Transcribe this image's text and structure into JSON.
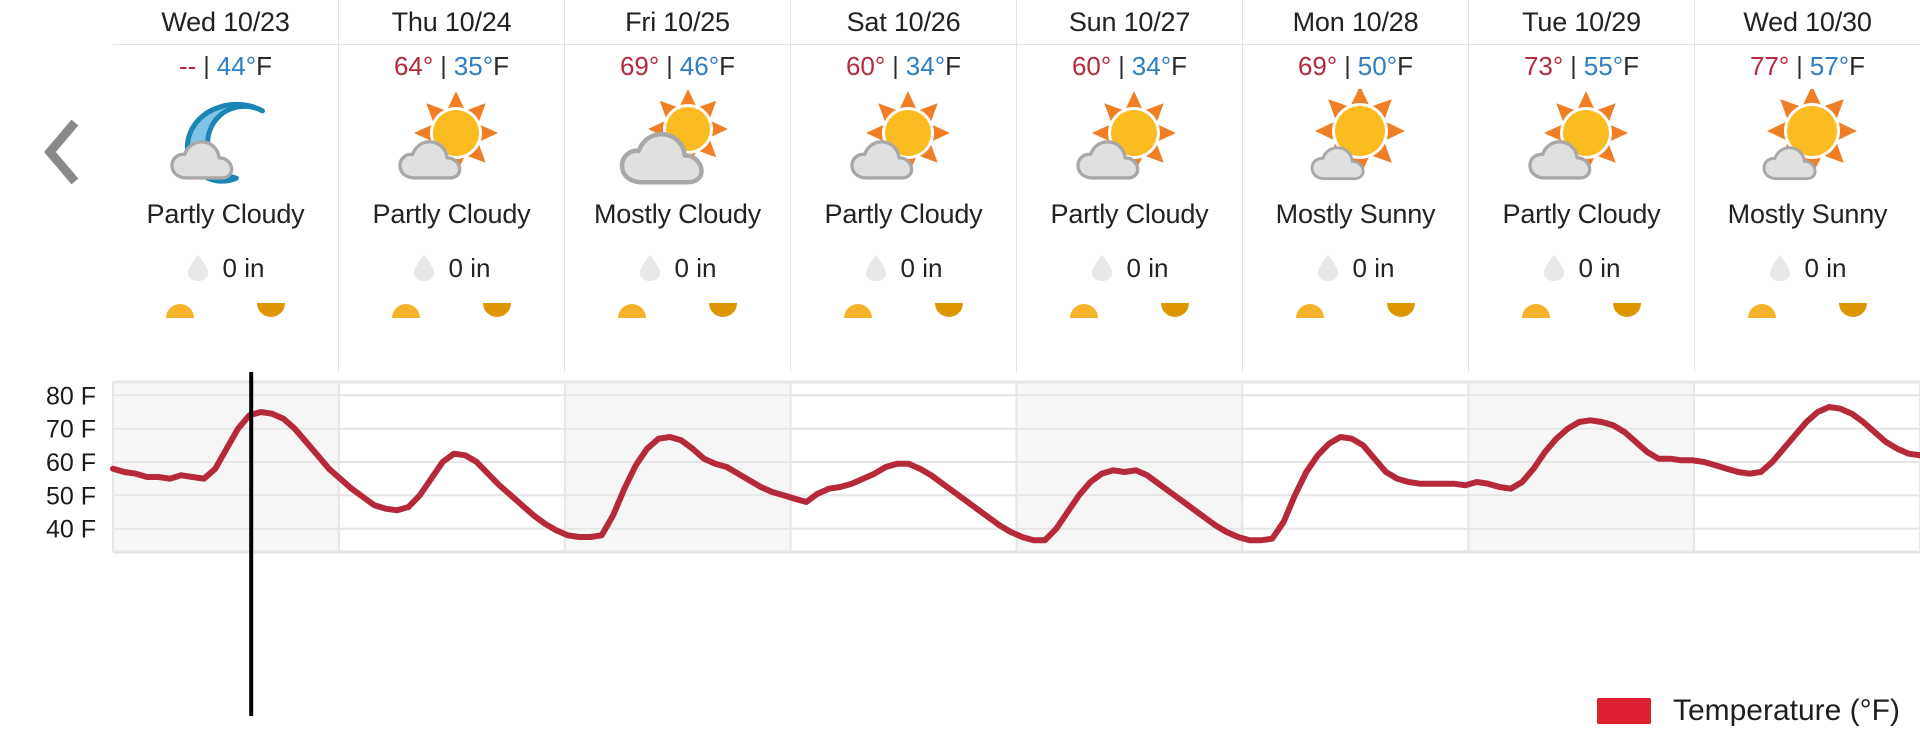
{
  "nav": {
    "prev_label": "previous days",
    "prev_icon": "chevron-left-icon"
  },
  "units": {
    "degree": "°",
    "fahrenheit": "°F",
    "separator": "|"
  },
  "days": [
    {
      "date": "Wed 10/23",
      "high": "--",
      "low": "44",
      "high_suffix": "",
      "condition": "Partly Cloudy",
      "precip": "0 in",
      "icon": "moon-cloud-icon",
      "precip_icon": "raindrop-icon",
      "sunrise_icon": "sunrise-icon",
      "sunset_icon": "sunset-icon"
    },
    {
      "date": "Thu 10/24",
      "high": "64",
      "low": "35",
      "high_suffix": "°",
      "condition": "Partly Cloudy",
      "precip": "0 in",
      "icon": "sun-cloud-icon",
      "precip_icon": "raindrop-icon",
      "sunrise_icon": "sunrise-icon",
      "sunset_icon": "sunset-icon"
    },
    {
      "date": "Fri 10/25",
      "high": "69",
      "low": "46",
      "high_suffix": "°",
      "condition": "Mostly Cloudy",
      "precip": "0 in",
      "icon": "cloud-sun-icon",
      "precip_icon": "raindrop-icon",
      "sunrise_icon": "sunrise-icon",
      "sunset_icon": "sunset-icon"
    },
    {
      "date": "Sat 10/26",
      "high": "60",
      "low": "34",
      "high_suffix": "°",
      "condition": "Partly Cloudy",
      "precip": "0 in",
      "icon": "sun-cloud-icon",
      "precip_icon": "raindrop-icon",
      "sunrise_icon": "sunrise-icon",
      "sunset_icon": "sunset-icon"
    },
    {
      "date": "Sun 10/27",
      "high": "60",
      "low": "34",
      "high_suffix": "°",
      "condition": "Partly Cloudy",
      "precip": "0 in",
      "icon": "sun-cloud-icon",
      "precip_icon": "raindrop-icon",
      "sunrise_icon": "sunrise-icon",
      "sunset_icon": "sunset-icon"
    },
    {
      "date": "Mon 10/28",
      "high": "69",
      "low": "50",
      "high_suffix": "°",
      "condition": "Mostly Sunny",
      "precip": "0 in",
      "icon": "sun-small-cloud-icon",
      "precip_icon": "raindrop-icon",
      "sunrise_icon": "sunrise-icon",
      "sunset_icon": "sunset-icon"
    },
    {
      "date": "Tue 10/29",
      "high": "73",
      "low": "55",
      "high_suffix": "°",
      "condition": "Partly Cloudy",
      "precip": "0 in",
      "icon": "sun-cloud-icon",
      "precip_icon": "raindrop-icon",
      "sunrise_icon": "sunrise-icon",
      "sunset_icon": "sunset-icon"
    },
    {
      "date": "Wed 10/30",
      "high": "77",
      "low": "57",
      "high_suffix": "°",
      "condition": "Mostly Sunny",
      "precip": "0 in",
      "icon": "sun-small-cloud-icon",
      "precip_icon": "raindrop-icon",
      "sunrise_icon": "sunrise-icon",
      "sunset_icon": "sunset-icon"
    }
  ],
  "legend": {
    "label": "Temperature (°F)",
    "color": "#dc2030"
  },
  "colors": {
    "line": "#b5293a",
    "high_temp": "#b5293a",
    "low_temp": "#2f7fc4",
    "grid": "#e6e6e6",
    "band": "#f6f6f6",
    "current_time_line": "#000000",
    "sunrise": "#f5b32b",
    "sunset": "#dd9500",
    "cloud": "#e0e0e0",
    "cloud_outline": "#a8a8a8",
    "sun": "#fbbc22",
    "sun_ray": "#ef7e24",
    "moon": "#7ec4e8",
    "moon_outline": "#1a85b5",
    "raindrop": "#e8e8e8"
  },
  "chart_data": {
    "type": "line",
    "title": "",
    "xlabel": "",
    "ylabel": "",
    "ylim": [
      33,
      84
    ],
    "yticks": [
      40,
      50,
      60,
      70,
      80
    ],
    "ytick_labels": [
      "40 F",
      "50 F",
      "60 F",
      "70 F",
      "80 F"
    ],
    "grid": true,
    "legend_position": "bottom-right",
    "series": [
      {
        "name": "Temperature (°F)",
        "color": "#b5293a",
        "values": [
          58,
          57,
          56.5,
          55.5,
          55.5,
          55,
          56,
          55.5,
          55,
          58,
          64,
          70,
          74,
          75,
          74.5,
          73,
          70,
          66,
          62,
          58,
          55,
          52,
          49.5,
          47,
          46,
          45.5,
          46.5,
          50,
          55,
          60,
          62.5,
          62,
          60,
          56.5,
          53,
          50,
          47,
          44,
          41.5,
          39.5,
          38,
          37.5,
          37.5,
          38,
          44,
          52,
          59,
          64,
          67,
          67.5,
          66.5,
          64,
          61,
          59.5,
          58.5,
          56.5,
          54.5,
          52.5,
          51,
          50,
          49,
          48,
          50.5,
          52,
          52.5,
          53.5,
          55,
          56.5,
          58.5,
          59.5,
          59.5,
          58,
          56,
          53.5,
          51,
          48.5,
          46,
          43.5,
          41,
          39,
          37.5,
          36.5,
          36.5,
          40,
          45,
          50,
          54,
          56.5,
          57.5,
          57,
          57.5,
          56,
          53.5,
          51,
          48.5,
          46,
          43.5,
          41,
          39,
          37.5,
          36.5,
          36.5,
          37,
          42,
          50,
          57,
          62,
          65.5,
          67.5,
          67,
          65,
          61,
          57,
          55,
          54,
          53.5,
          53.5,
          53.5,
          53.5,
          53,
          54,
          53.5,
          52.5,
          52,
          54,
          58,
          63,
          67,
          70,
          72,
          72.5,
          72,
          71,
          69,
          66,
          63,
          61,
          61,
          60.5,
          60.5,
          60,
          59,
          58,
          57,
          56.5,
          57,
          60,
          64,
          68,
          72,
          75,
          76.5,
          76,
          74.5,
          72,
          69,
          66,
          64,
          62.5,
          62
        ]
      }
    ],
    "current_time_marker": {
      "present": true,
      "position_fraction": 0.0765
    },
    "day_boundaries": [
      "Wed 10/23",
      "Thu 10/24",
      "Fri 10/25",
      "Sat 10/26",
      "Sun 10/27",
      "Mon 10/28",
      "Tue 10/29",
      "Wed 10/30"
    ]
  }
}
